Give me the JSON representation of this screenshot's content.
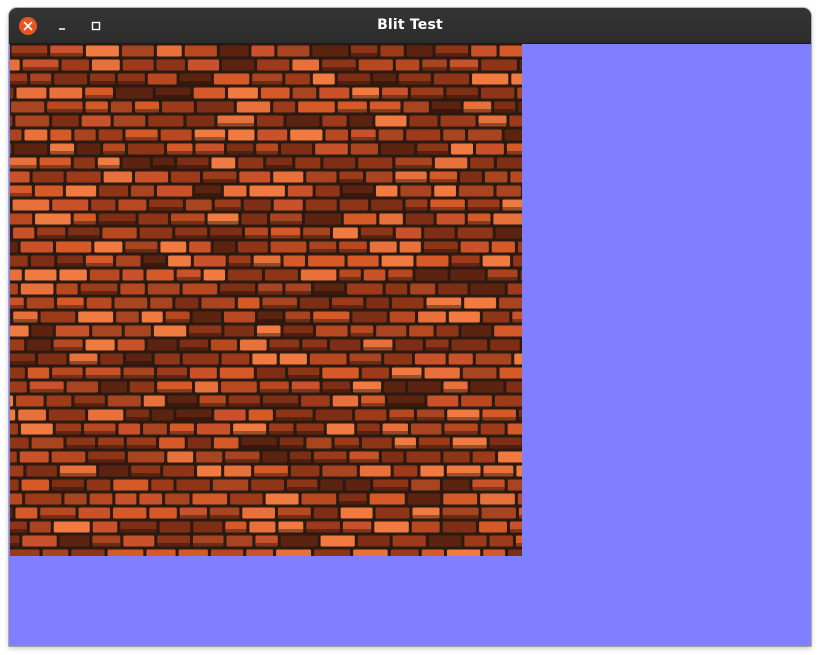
{
  "window": {
    "title": "Blit Test"
  },
  "icons": {
    "close": "close-icon",
    "minimize": "minimize-icon",
    "maximize": "maximize-icon"
  },
  "colors": {
    "titlebar": "#2c2c2c",
    "close_button": "#e95420",
    "background": "#7f7fff",
    "brick_light": "#e06a35",
    "brick_dark": "#8a3218",
    "mortar": "#2a1a12"
  }
}
